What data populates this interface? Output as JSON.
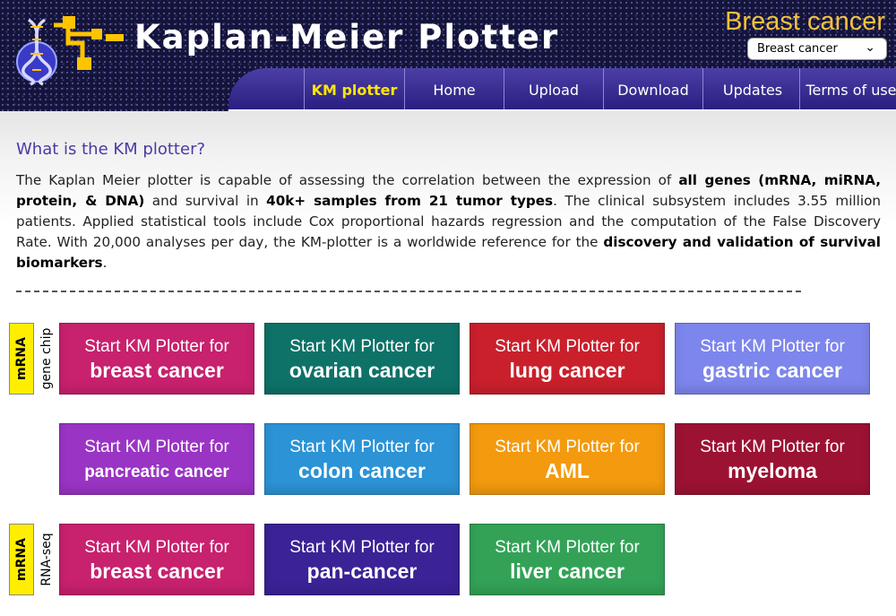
{
  "header": {
    "site_title": "Kaplan-Meier Plotter",
    "cancer_title": "Breast cancer",
    "cancer_select_value": "Breast cancer",
    "logo_icon": "dna-circuit-logo-icon"
  },
  "nav": {
    "items": [
      {
        "label": "KM plotter",
        "active": true
      },
      {
        "label": "Home"
      },
      {
        "label": "Upload"
      },
      {
        "label": "Download"
      },
      {
        "label": "Updates"
      },
      {
        "label": "Terms of use"
      }
    ]
  },
  "intro": {
    "title": "What is the KM plotter?",
    "t1": "The Kaplan Meier plotter is capable of assessing the correlation between the expression of ",
    "b1": "all genes (mRNA, miRNA, protein, & DNA)",
    "t2": " and survival in ",
    "b2": "40k+ samples from 21 tumor types",
    "t3": ". The clinical subsystem includes 3.55 million patients. Applied statistical tools include Cox proportional hazards regression and the computation of the False Discovery Rate. With 20,000 analyses per day, the KM-plotter is a worldwide reference for the ",
    "b3": "discovery and validation of survival biomarkers",
    "t4": ".",
    "divider": "--------------------------------------------------------------------------------------------------------------------"
  },
  "sections": {
    "genechip": {
      "label": "mRNA",
      "sublabel": "gene chip"
    },
    "rnaseq": {
      "label": "mRNA",
      "sublabel": "RNA-seq"
    }
  },
  "tiles": [
    {
      "line1": "Start KM Plotter for",
      "line2": "breast cancer",
      "color": "#c8216e"
    },
    {
      "line1": "Start KM Plotter for",
      "line2": "ovarian cancer",
      "color": "#0e7268"
    },
    {
      "line1": "Start KM Plotter for",
      "line2": "lung cancer",
      "color": "#c9202c"
    },
    {
      "line1": "Start KM Plotter for",
      "line2": "gastric cancer",
      "color": "#7d86ec"
    },
    {
      "line1": "Start KM Plotter for",
      "line2": "pancreatic cancer",
      "color": "#9a34c4"
    },
    {
      "line1": "Start KM Plotter for",
      "line2": "colon cancer",
      "color": "#2b93d6"
    },
    {
      "line1": "Start KM Plotter for",
      "line2": "AML",
      "color": "#f39a0e"
    },
    {
      "line1": "Start KM Plotter for",
      "line2": "myeloma",
      "color": "#9c1233"
    },
    {
      "line1": "Start KM Plotter for",
      "line2": "breast cancer",
      "color": "#c8216e"
    },
    {
      "line1": "Start KM Plotter for",
      "line2": "pan-cancer",
      "color": "#3b2296"
    },
    {
      "line1": "Start KM Plotter for",
      "line2": "liver cancer",
      "color": "#33a257"
    }
  ]
}
